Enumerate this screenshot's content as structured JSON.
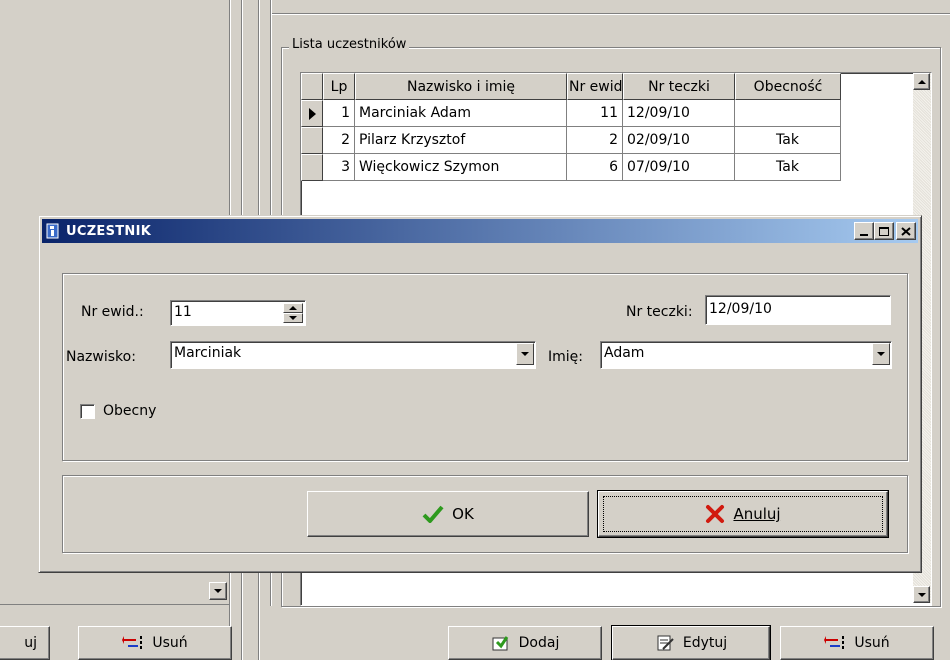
{
  "group_title": "Lista uczestników",
  "grid": {
    "columns": [
      "Lp",
      "Nazwisko i imię",
      "Nr ewid.",
      "Nr teczki",
      "Obecność"
    ],
    "rows": [
      {
        "lp": "1",
        "name": "Marciniak Adam",
        "nr_ewid": "11",
        "nr_teczki": "12/09/10",
        "obecnosc": ""
      },
      {
        "lp": "2",
        "name": "Pilarz Krzysztof",
        "nr_ewid": "2",
        "nr_teczki": "02/09/10",
        "obecnosc": "Tak"
      },
      {
        "lp": "3",
        "name": "Więckowicz Szymon",
        "nr_ewid": "6",
        "nr_teczki": "07/09/10",
        "obecnosc": "Tak"
      }
    ]
  },
  "bottom_buttons": {
    "left_partial": "uj",
    "left_delete": "Usuń",
    "add": "Dodaj",
    "edit": "Edytuj",
    "delete": "Usuń"
  },
  "dialog": {
    "title": "UCZESTNIK",
    "nr_ewid_label": "Nr ewid.:",
    "nr_ewid_value": "11",
    "nr_teczki_label": "Nr teczki:",
    "nr_teczki_value": "12/09/10",
    "nazwisko_label": "Nazwisko:",
    "nazwisko_value": "Marciniak",
    "imie_label": "Imię:",
    "imie_value": "Adam",
    "obecny_label": "Obecny",
    "ok_label": "OK",
    "cancel_label": "Anuluj"
  },
  "colors": {
    "title_start": "#0a246a",
    "title_end": "#a6caf0",
    "window_bg": "#d4d0c8",
    "ok_check": "#2e9a1e",
    "cancel_x": "#d11a0f"
  },
  "icons": {
    "app": "app-icon",
    "ok": "checkmark-icon",
    "cancel": "red-x-icon",
    "add": "add-icon",
    "edit": "edit-icon",
    "delete": "delete-icon"
  }
}
